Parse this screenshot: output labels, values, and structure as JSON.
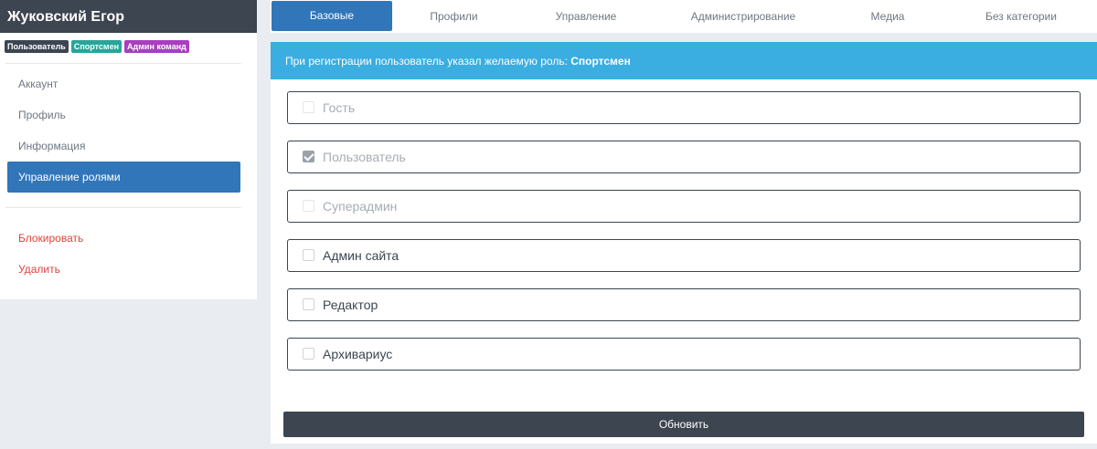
{
  "sidebar": {
    "title": "Жуковский Егор",
    "badges": [
      "Пользователь",
      "Спортсмен",
      "Админ команд"
    ],
    "nav": [
      {
        "label": "Аккаунт"
      },
      {
        "label": "Профиль"
      },
      {
        "label": "Информация"
      },
      {
        "label": "Управление ролями",
        "active": true
      }
    ],
    "actions": [
      {
        "label": "Блокировать"
      },
      {
        "label": "Удалить"
      }
    ]
  },
  "tabs": [
    {
      "label": "Базовые",
      "active": true
    },
    {
      "label": "Профили"
    },
    {
      "label": "Управление"
    },
    {
      "label": "Администрирование"
    },
    {
      "label": "Медиа"
    },
    {
      "label": "Без категории"
    }
  ],
  "alert": {
    "text": "При регистрации пользователь указал желаемую роль: ",
    "role": "Спортсмен"
  },
  "roles": [
    {
      "label": "Гость",
      "checked": false,
      "disabled": true
    },
    {
      "label": "Пользователь",
      "checked": true,
      "disabled": true
    },
    {
      "label": "Суперадмин",
      "checked": false,
      "disabled": true
    },
    {
      "label": "Админ сайта",
      "checked": false,
      "disabled": false
    },
    {
      "label": "Редактор",
      "checked": false,
      "disabled": false
    },
    {
      "label": "Архивариус",
      "checked": false,
      "disabled": false
    }
  ],
  "update_label": "Обновить",
  "colors": {
    "primary": "#3176b9",
    "dark": "#3c4550",
    "info": "#3aade1",
    "danger": "#e0443c",
    "badge_teal": "#26a69a",
    "badge_purple": "#a83fbf"
  }
}
